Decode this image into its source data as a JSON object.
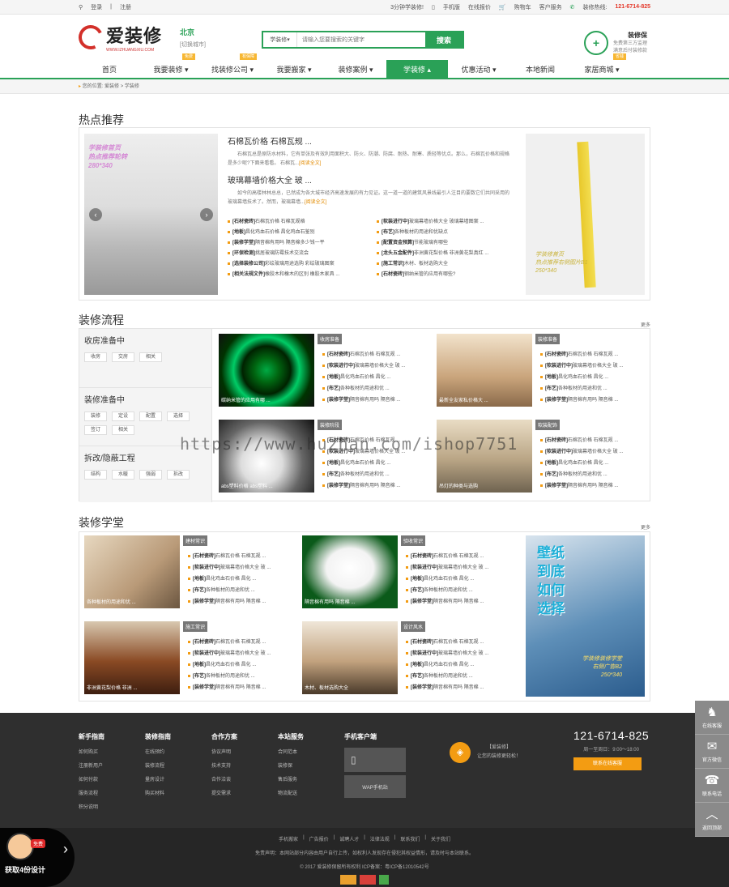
{
  "topbar": {
    "login": "登录",
    "register": "注册",
    "quick": "3分钟学装修!",
    "mobile": "手机版",
    "online_price": "在线报价",
    "cart": "购物车",
    "service": "客户服务",
    "hotline_label": "装修热线:",
    "hotline": "121-6714-825"
  },
  "header": {
    "logo": "爱装修",
    "logo_sub": "WWW.IZHUANGXIU.COM",
    "city": "北京",
    "switch_city": "[切换城市]",
    "search_type": "学装修",
    "search_placeholder": "请输入您要搜索的关键字",
    "search_btn": "搜索",
    "guard_title": "装修保",
    "guard_line1": "免费第三方监理",
    "guard_line2": "满意后付装修款"
  },
  "nav": [
    {
      "label": "首页",
      "badge": ""
    },
    {
      "label": "我要装修 ▾",
      "badge": "免费"
    },
    {
      "label": "找装修公司 ▾",
      "badge": "有保障"
    },
    {
      "label": "我要搬家 ▾",
      "badge": ""
    },
    {
      "label": "装修案例 ▾",
      "badge": ""
    },
    {
      "label": "学装修 ▴",
      "badge": ""
    },
    {
      "label": "优惠活动 ▾",
      "badge": ""
    },
    {
      "label": "本地新闻",
      "badge": ""
    },
    {
      "label": "家居商城 ▾",
      "badge": "省钱"
    }
  ],
  "crumb": "您的位置: 爱装修 > 学装修",
  "hot": {
    "title": "热点推荐",
    "img_caption": [
      "学装修首页",
      "热点推荐轮转",
      "280*340"
    ],
    "a1_title": "石棉瓦价格 石棉瓦规 ...",
    "a1_text": "石棉瓦总是原防水材料，它有单张及有效利用面积大、防火、防潮、防腐、耐热、耐寒、质轻等优点。那么，石棉瓦价格和规格是多少呢?下面来看看。",
    "a1_tail": "石棉瓦...",
    "a2_title": "玻璃幕墙价格大全 玻 ...",
    "a2_text": "如今的高楼林林总总，已然成为各大城市经济高速发展的有力见证。这一道一道的建筑风景线最引人注目的要数它们共同采用的玻璃幕墙技术了。然而，玻璃幕墙...",
    "read": "[阅读全文]",
    "list": [
      {
        "tag": "[石材瓷砖]",
        "text": "石棉瓦价格 石棉瓦规格"
      },
      {
        "tag": "[软装进行中]",
        "text": "玻璃幕墙价格大全 玻璃幕墙图案 ..."
      },
      {
        "tag": "[地板]",
        "text": "昌化鸡血石价格 昌化鸡血石鉴别"
      },
      {
        "tag": "[布艺]",
        "text": "各种板材的用途和优缺点"
      },
      {
        "tag": "[装修学堂]",
        "text": "隔音棉有用吗 隔音棉多少钱一平"
      },
      {
        "tag": "[配置资金预算]",
        "text": "节能玻璃有哪些"
      },
      {
        "tag": "[环保检测]",
        "text": "挑居玻璃防霉技术交流会"
      },
      {
        "tag": "[龙头五金配件]",
        "text": "非洲黄花梨价格 非洲黄花梨真红 ..."
      },
      {
        "tag": "[选择装修公司]",
        "text": "彩绘玻璃用途选购 彩绘玻璃图案"
      },
      {
        "tag": "[施工常识]",
        "text": "木材、板材选购大全"
      },
      {
        "tag": "[相关法规文件]",
        "text": "橡胶木和橡木的区别 橡胶木家具 ..."
      },
      {
        "tag": "[石材瓷砖]",
        "text": "钢纳米管的应用有哪些?"
      }
    ],
    "right_caption": [
      "学装修首页",
      "热点推荐右侧图片B1",
      "250*340"
    ]
  },
  "process": {
    "title": "装修流程",
    "more": "更多",
    "groups": [
      {
        "title": "收房准备中",
        "tags": [
          "收房",
          "交房",
          "相关"
        ]
      },
      {
        "title": "装修准备中",
        "tags": [
          "装修",
          "定设",
          "配置",
          "选择",
          "签订",
          "相关"
        ]
      },
      {
        "title": "拆改/隐蔽工程",
        "tags": [
          "结构",
          "水暖",
          "强弱",
          "拆改"
        ]
      }
    ],
    "cards": [
      {
        "label": "收房准备",
        "img": "碳纳米管的应用有哪 ...",
        "lines": [
          [
            "[石材瓷砖]",
            "石棉瓦价格 石棉瓦规 ..."
          ],
          [
            "[软装进行中]",
            "玻璃幕墙价格大全 玻 ..."
          ],
          [
            "[地板]",
            "昌化鸡血石价格 昌化 ..."
          ],
          [
            "[布艺]",
            "各种板材的用途和优 ..."
          ],
          [
            "[装修学堂]",
            "隔音棉有用吗 隔音棉 ..."
          ]
        ]
      },
      {
        "label": "装修准备",
        "img": "最新全友家私价格大 ...",
        "lines": [
          [
            "[石材瓷砖]",
            "石棉瓦价格 石棉瓦规 ..."
          ],
          [
            "[软装进行中]",
            "玻璃幕墙价格大全 玻 ..."
          ],
          [
            "[地板]",
            "昌化鸡血石价格 昌化 ..."
          ],
          [
            "[布艺]",
            "各种板材的用途和优 ..."
          ],
          [
            "[装修学堂]",
            "隔音棉有用吗 隔音棉 ..."
          ]
        ]
      },
      {
        "label": "装修阶段",
        "img": "abs塑料价格 abs塑料 ...",
        "lines": [
          [
            "[石材瓷砖]",
            "石棉瓦价格 石棉瓦规 ..."
          ],
          [
            "[软装进行中]",
            "玻璃幕墙价格大全 玻 ..."
          ],
          [
            "[地板]",
            "昌化鸡血石价格 昌化 ..."
          ],
          [
            "[布艺]",
            "各种板材的用途和优 ..."
          ],
          [
            "[装修学堂]",
            "隔音棉有用吗 隔音棉 ..."
          ]
        ]
      },
      {
        "label": "软装配饰",
        "img": "吊灯的种类与选购",
        "lines": [
          [
            "[石材瓷砖]",
            "石棉瓦价格 石棉瓦规 ..."
          ],
          [
            "[软装进行中]",
            "玻璃幕墙价格大全 玻 ..."
          ],
          [
            "[地板]",
            "昌化鸡血石价格 昌化 ..."
          ],
          [
            "[布艺]",
            "各种板材的用途和优 ..."
          ],
          [
            "[装修学堂]",
            "隔音棉有用吗 隔音棉 ..."
          ]
        ]
      }
    ]
  },
  "school": {
    "title": "装修学堂",
    "more": "更多",
    "cards": [
      {
        "label": "建材常识",
        "img": "各种板材的用途和优 ..."
      },
      {
        "label": "验收常识",
        "img": "隔音棉有用吗 隔音棉 ..."
      },
      {
        "label": "施工常识",
        "img": "非洲黄花梨价格 非洲 ..."
      },
      {
        "label": "设计风水",
        "img": "木材、板材选购大全"
      }
    ],
    "lines": [
      [
        "[石材瓷砖]",
        "石棉瓦价格 石棉瓦规 ..."
      ],
      [
        "[软装进行中]",
        "玻璃幕墙价格大全 玻 ..."
      ],
      [
        "[地板]",
        "昌化鸡血石价格 昌化 ..."
      ],
      [
        "[布艺]",
        "各种板材的用途和优 ..."
      ],
      [
        "[装修学堂]",
        "隔音棉有用吗 隔音棉 ..."
      ]
    ],
    "promo_big": [
      "壁纸",
      "到底",
      "如何",
      "选择"
    ],
    "promo_caption": [
      "学装修装修学堂",
      "右侧广告B2",
      "250*340"
    ]
  },
  "footer": {
    "cols": [
      {
        "title": "新手指南",
        "items": [
          "如何购买",
          "注册新用户",
          "如何付款",
          "服务流程",
          "积分说明"
        ]
      },
      {
        "title": "装修指南",
        "items": [
          "在线预约",
          "装修流程",
          "量房设计",
          "购买材料"
        ]
      },
      {
        "title": "合作方案",
        "items": [
          "协议声明",
          "技术支持",
          "合作洽谈",
          "提交需求"
        ]
      },
      {
        "title": "本站服务",
        "items": [
          "合同范本",
          "装修保",
          "售后服务",
          "物流配送"
        ]
      }
    ],
    "app_title": "手机客户端",
    "wap": "WAP手机站",
    "brand": "【爱装修】",
    "brand_slogan": "让您的装修更轻松！",
    "phone": "121-6714-825",
    "hours": "周一至周日：9:00～18:00",
    "consult": "联系在线客服",
    "links": [
      "手机搬家",
      "广告报价",
      "诚聘人才",
      "法律法规",
      "联系我们",
      "关于我们"
    ],
    "disclaimer": "免责声明：本网站部分内容由用户自行上传，如权利人发现存在侵犯其权益情形，请及时与本站联系。",
    "copyright": "© 2017 爱装修保留所有权利  ICP备案：粤ICP备12010542号"
  },
  "float": [
    {
      "icon": "♞",
      "label": "在线客服"
    },
    {
      "icon": "✉",
      "label": "官方微信"
    },
    {
      "icon": "☎",
      "label": "联系电话"
    },
    {
      "icon": "︿",
      "label": "返回顶部"
    }
  ],
  "freebadge": {
    "hat": "免费",
    "label": "获取4份设计"
  },
  "watermark": "https://www.huzhan.com/ishop7751"
}
